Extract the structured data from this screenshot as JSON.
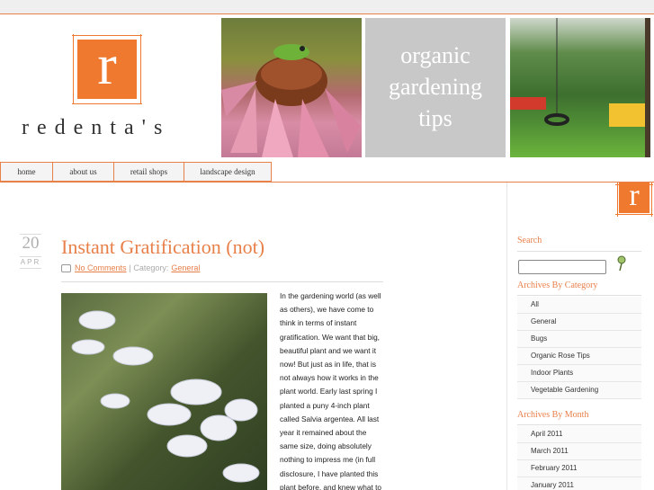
{
  "header": {
    "logo_letter": "r",
    "wordmark": "redenta's",
    "tagline_lines": [
      "organic",
      "gardening",
      "tips"
    ]
  },
  "nav": {
    "items": [
      {
        "label": "home"
      },
      {
        "label": "about us"
      },
      {
        "label": "retail shops"
      },
      {
        "label": "landscape design"
      }
    ]
  },
  "post": {
    "date_day": "20",
    "date_month": "APR",
    "title": "Instant Gratification (not)",
    "comments_link": "No Comments",
    "category_prefix": "| Category:",
    "category_link": "General",
    "body": "In the gardening world (as well as others), we have come to think in terms of instant gratification. We want that big, beautiful plant and we want it now! But just as in life, that is not always how it works in the plant world. Early last spring I planted a puny 4-inch plant called Salvia argentea. All last year it remained about the same size, doing absolutely nothing to impress me (in full disclosure, I have planted this plant before, and knew what to expect!)). Towards the end of"
  },
  "sidebar": {
    "logo_letter": "r",
    "search_heading": "Search",
    "search_value": "",
    "categories_heading": "Archives By Category",
    "categories": [
      "All",
      "General",
      "Bugs",
      "Organic Rose Tips",
      "Indoor Plants",
      "Vegetable Gardening"
    ],
    "months_heading": "Archives By Month",
    "months": [
      "April 2011",
      "March 2011",
      "February 2011",
      "January 2011"
    ]
  },
  "colors": {
    "accent": "#e8804a",
    "brand_orange": "#ef7a2f",
    "tagline_bg": "#c8c8c8"
  }
}
